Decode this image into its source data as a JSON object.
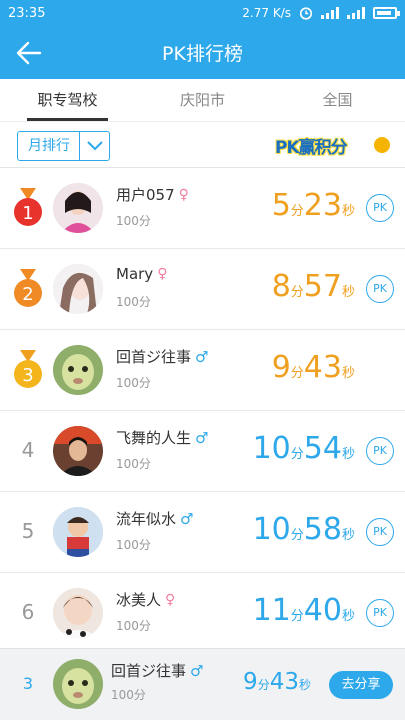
{
  "status": {
    "time": "23:35",
    "speed": "2.77 K/s"
  },
  "header": {
    "title": "PK排行榜"
  },
  "tabs": [
    {
      "label": "职专驾校",
      "active": true
    },
    {
      "label": "庆阳市",
      "active": false
    },
    {
      "label": "全国",
      "active": false
    }
  ],
  "filter": {
    "sort_label": "月排行",
    "banner_text": "PK赢积分"
  },
  "rows": [
    {
      "rank": "1",
      "medal": "gold-red",
      "name": "用户057",
      "gender": "female",
      "gender_symbol": "♀",
      "score": "100分",
      "min": "5",
      "min_unit": "分",
      "sec": "23",
      "sec_unit": "秒",
      "color": "orange",
      "pk": "PK",
      "show_pk": true
    },
    {
      "rank": "2",
      "medal": "orange",
      "name": "Mary",
      "gender": "female",
      "gender_symbol": "♀",
      "score": "100分",
      "min": "8",
      "min_unit": "分",
      "sec": "57",
      "sec_unit": "秒",
      "color": "orange",
      "pk": "PK",
      "show_pk": true
    },
    {
      "rank": "3",
      "medal": "yellow",
      "name": "回首ジ往事",
      "gender": "male",
      "gender_symbol": "♂",
      "score": "100分",
      "min": "9",
      "min_unit": "分",
      "sec": "43",
      "sec_unit": "秒",
      "color": "orange",
      "pk": "",
      "show_pk": false
    },
    {
      "rank": "4",
      "medal": "",
      "name": "飞舞的人生",
      "gender": "male",
      "gender_symbol": "♂",
      "score": "100分",
      "min": "10",
      "min_unit": "分",
      "sec": "54",
      "sec_unit": "秒",
      "color": "blue",
      "pk": "PK",
      "show_pk": true
    },
    {
      "rank": "5",
      "medal": "",
      "name": "流年似水",
      "gender": "male",
      "gender_symbol": "♂",
      "score": "100分",
      "min": "10",
      "min_unit": "分",
      "sec": "58",
      "sec_unit": "秒",
      "color": "blue",
      "pk": "PK",
      "show_pk": true
    },
    {
      "rank": "6",
      "medal": "",
      "name": "冰美人",
      "gender": "female",
      "gender_symbol": "♀",
      "score": "100分",
      "min": "11",
      "min_unit": "分",
      "sec": "40",
      "sec_unit": "秒",
      "color": "blue",
      "pk": "PK",
      "show_pk": true
    }
  ],
  "me": {
    "rank": "3",
    "name": "回首ジ往事",
    "gender_symbol": "♂",
    "score": "100分",
    "min": "9",
    "min_unit": "分",
    "sec": "43",
    "sec_unit": "秒",
    "share_label": "去分享"
  },
  "colors": {
    "accent": "#2da8ea",
    "gold": "#f0a020",
    "female": "#f07f9e"
  }
}
